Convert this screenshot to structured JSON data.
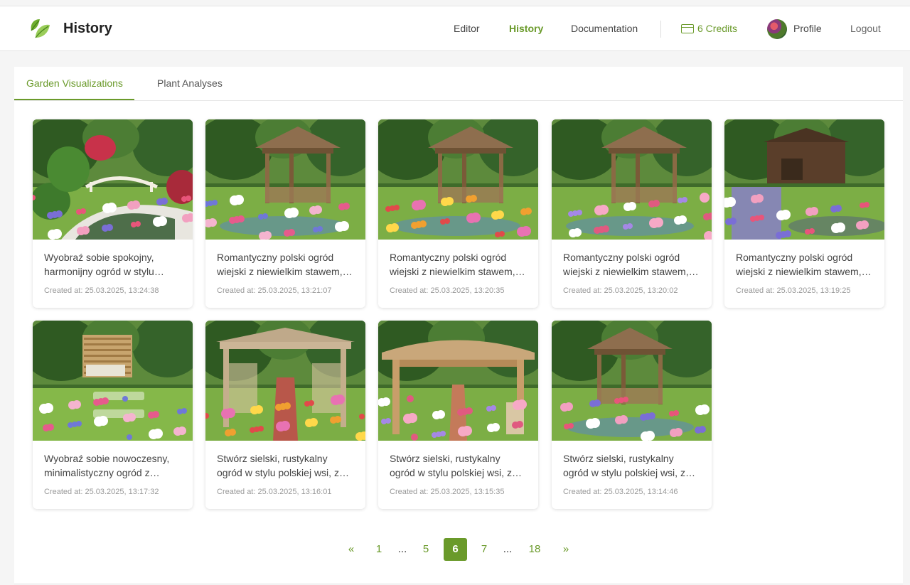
{
  "header": {
    "title": "History",
    "nav": {
      "editor": "Editor",
      "history": "History",
      "documentation": "Documentation",
      "credits": "6 Credits",
      "profile": "Profile",
      "logout": "Logout"
    }
  },
  "tabs": [
    {
      "label": "Garden Visualizations",
      "active": true
    },
    {
      "label": "Plant Analyses",
      "active": false
    }
  ],
  "cards": [
    {
      "text": "Wyobraź sobie spokojny, harmonijny ogród w stylu japońskim",
      "date": "Created at: 25.03.2025, 13:24:38",
      "scene": "bridge"
    },
    {
      "text": "Romantyczny polski ogród wiejski z niewielkim stawem, altaną",
      "date": "Created at: 25.03.2025, 13:21:07",
      "scene": "gazebo"
    },
    {
      "text": "Romantyczny polski ogród wiejski z niewielkim stawem, altaną",
      "date": "Created at: 25.03.2025, 13:20:35",
      "scene": "gazebo"
    },
    {
      "text": "Romantyczny polski ogród wiejski z niewielkim stawem, altaną",
      "date": "Created at: 25.03.2025, 13:20:02",
      "scene": "gazebo"
    },
    {
      "text": "Romantyczny polski ogród wiejski z niewielkim stawem, altaną",
      "date": "Created at: 25.03.2025, 13:19:25",
      "scene": "shed"
    },
    {
      "text": "Wyobraź sobie nowoczesny, minimalistyczny ogród z pergolą",
      "date": "Created at: 25.03.2025, 13:17:32",
      "scene": "modern"
    },
    {
      "text": "Stwórz sielski, rustykalny ogród w stylu polskiej wsi, z altaną",
      "date": "Created at: 25.03.2025, 13:16:01",
      "scene": "pergola"
    },
    {
      "text": "Stwórz sielski, rustykalny ogród w stylu polskiej wsi, z altaną",
      "date": "Created at: 25.03.2025, 13:15:35",
      "scene": "arbor"
    },
    {
      "text": "Stwórz sielski, rustykalny ogród w stylu polskiej wsi, z altaną",
      "date": "Created at: 25.03.2025, 13:14:46",
      "scene": "tower"
    }
  ],
  "pagination": {
    "prev": "«",
    "first": "1",
    "dots": "...",
    "p5": "5",
    "current": "6",
    "p7": "7",
    "last": "18",
    "next": "»"
  },
  "colors": {
    "accent": "#6a9a2a"
  }
}
